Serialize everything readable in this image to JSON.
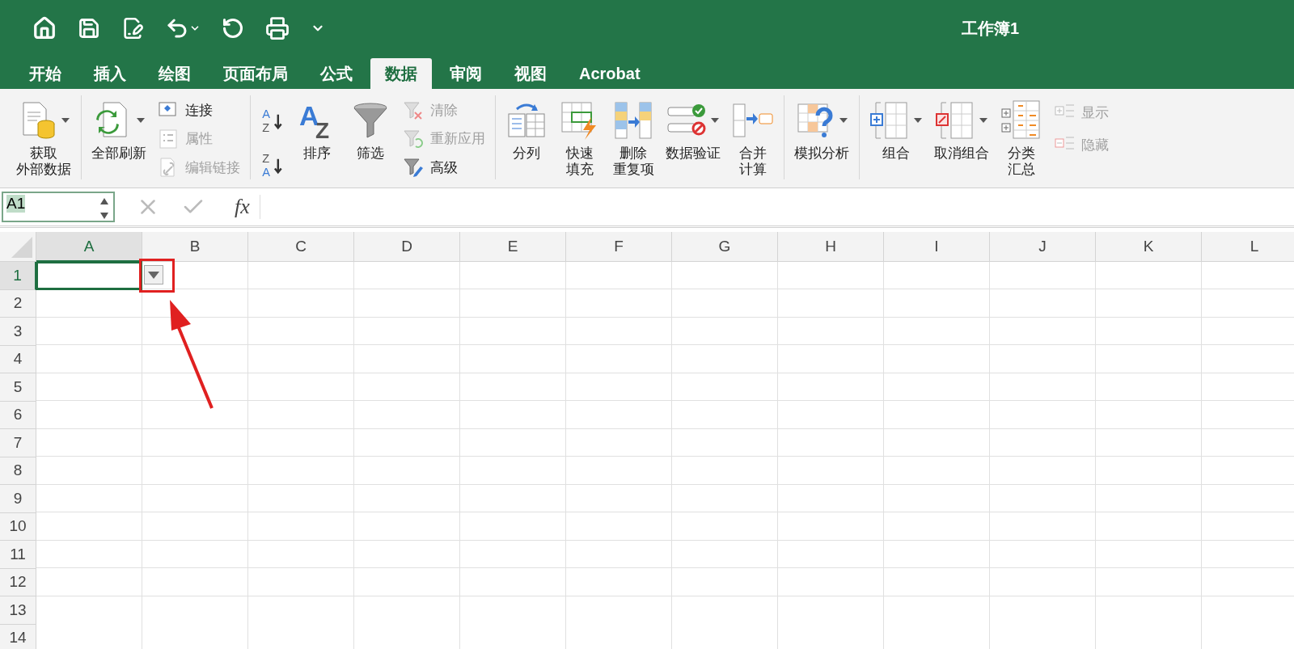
{
  "window": {
    "title": "工作簿1"
  },
  "tabs": [
    {
      "label": "开始",
      "selected": false
    },
    {
      "label": "插入",
      "selected": false
    },
    {
      "label": "绘图",
      "selected": false
    },
    {
      "label": "页面布局",
      "selected": false
    },
    {
      "label": "公式",
      "selected": false
    },
    {
      "label": "数据",
      "selected": true
    },
    {
      "label": "审阅",
      "selected": false
    },
    {
      "label": "视图",
      "selected": false
    },
    {
      "label": "Acrobat",
      "selected": false
    }
  ],
  "ribbon": [
    {
      "items": [
        {
          "kind": "large",
          "label_lines": [
            "获取",
            "外部数据"
          ],
          "dropdown": true
        }
      ]
    },
    {
      "items": [
        {
          "kind": "large",
          "label": "全部刷新",
          "dropdown": true
        },
        {
          "kind": "stack",
          "entries": [
            {
              "label": "连接",
              "disabled": false
            },
            {
              "label": "属性",
              "disabled": true
            },
            {
              "label": "编辑链接",
              "disabled": true
            }
          ]
        }
      ]
    },
    {
      "items": [
        {
          "kind": "sort",
          "pairs": [
            [
              "A",
              "Z"
            ],
            [
              "Z",
              "A"
            ]
          ]
        },
        {
          "kind": "large",
          "label": "排序",
          "glyph": [
            "A",
            "Z"
          ],
          "dropdown": false
        },
        {
          "kind": "large",
          "label": "筛选",
          "dropdown": false
        },
        {
          "kind": "stack",
          "entries": [
            {
              "label": "清除",
              "disabled": true
            },
            {
              "label": "重新应用",
              "disabled": true
            },
            {
              "label": "高级",
              "disabled": false
            }
          ]
        }
      ]
    },
    {
      "items": [
        {
          "kind": "large",
          "label": "分列",
          "dropdown": false
        },
        {
          "kind": "large",
          "label_lines": [
            "快速",
            "填充"
          ],
          "dropdown": false
        },
        {
          "kind": "large",
          "label_lines": [
            "删除",
            "重复项"
          ],
          "dropdown": false
        },
        {
          "kind": "large",
          "label": "数据验证",
          "dropdown": true
        },
        {
          "kind": "large",
          "label_lines": [
            "合并",
            "计算"
          ],
          "dropdown": false
        }
      ]
    },
    {
      "items": [
        {
          "kind": "large",
          "label": "模拟分析",
          "dropdown": true
        }
      ]
    },
    {
      "items": [
        {
          "kind": "large",
          "label": "组合",
          "dropdown": true
        },
        {
          "kind": "large",
          "label": "取消组合",
          "dropdown": true
        },
        {
          "kind": "large",
          "label_lines": [
            "分类",
            "汇总"
          ],
          "dropdown": false
        },
        {
          "kind": "stack",
          "entries": [
            {
              "label": "显示",
              "disabled": true
            },
            {
              "label": "隐藏",
              "disabled": true
            }
          ]
        }
      ]
    }
  ],
  "formula_bar": {
    "name_box": "A1",
    "function_label": "fx"
  },
  "sheet": {
    "columns": [
      {
        "label": "A",
        "selected": true
      },
      {
        "label": "B",
        "selected": false
      },
      {
        "label": "C",
        "selected": false
      },
      {
        "label": "D",
        "selected": false
      },
      {
        "label": "E",
        "selected": false
      },
      {
        "label": "F",
        "selected": false
      },
      {
        "label": "G",
        "selected": false
      },
      {
        "label": "H",
        "selected": false
      },
      {
        "label": "I",
        "selected": false
      },
      {
        "label": "J",
        "selected": false
      },
      {
        "label": "K",
        "selected": false
      },
      {
        "label": "L",
        "selected": false
      }
    ],
    "rows": [
      {
        "label": "1",
        "selected": true
      },
      {
        "label": "2",
        "selected": false
      },
      {
        "label": "3",
        "selected": false
      },
      {
        "label": "4",
        "selected": false
      },
      {
        "label": "5",
        "selected": false
      },
      {
        "label": "6",
        "selected": false
      },
      {
        "label": "7",
        "selected": false
      },
      {
        "label": "8",
        "selected": false
      },
      {
        "label": "9",
        "selected": false
      },
      {
        "label": "10",
        "selected": false
      },
      {
        "label": "11",
        "selected": false
      },
      {
        "label": "12",
        "selected": false
      },
      {
        "label": "13",
        "selected": false
      },
      {
        "label": "14",
        "selected": false
      }
    ],
    "dropdown_button": true,
    "annotation": true
  }
}
